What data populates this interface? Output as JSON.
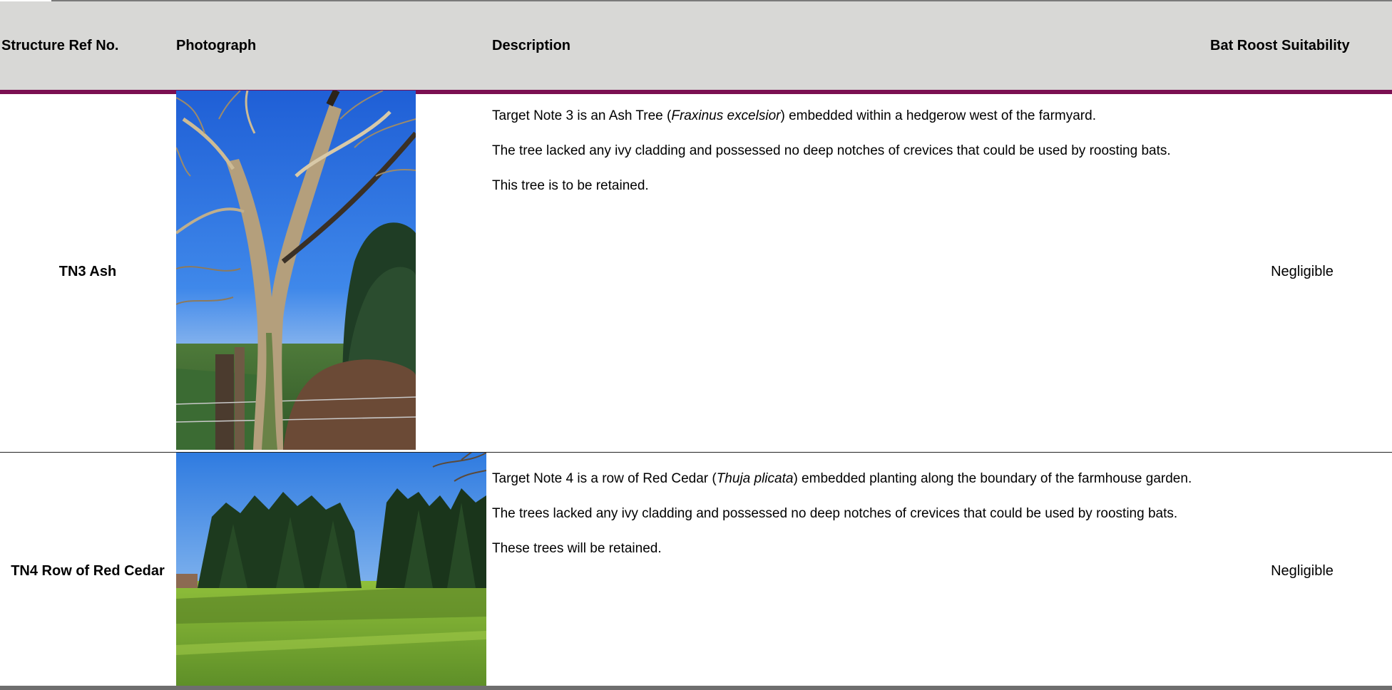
{
  "table": {
    "headers": {
      "ref": "Structure Ref No.",
      "photo": "Photograph",
      "description": "Description",
      "suitability": "Bat Roost Suitability"
    },
    "rows": [
      {
        "ref": "TN3 Ash",
        "photo_icon": "ash-tree-photo",
        "desc": {
          "p1_before": "Target Note 3 is an Ash Tree (",
          "p1_species": "Fraxinus excelsior",
          "p1_after": ") embedded within a hedgerow west of the farmyard.",
          "p2": "The tree lacked any ivy cladding and possessed no deep notches of crevices that could be used by roosting bats.",
          "p3": "This tree is to be retained."
        },
        "suitability": "Negligible"
      },
      {
        "ref": "TN4 Row of Red Cedar",
        "photo_icon": "red-cedar-row-photo",
        "desc": {
          "p1_before": "Target Note 4 is a row of Red Cedar (",
          "p1_species": "Thuja plicata",
          "p1_after": ") embedded planting along the boundary of the farmhouse garden.",
          "p2": "The trees lacked any ivy cladding and possessed no deep notches of crevices that could be used by roosting bats.",
          "p3": "These trees will be retained."
        },
        "suitability": "Negligible"
      }
    ]
  },
  "colors": {
    "header_bg": "#d8d8d6",
    "header_rule": "#7b0f52"
  }
}
